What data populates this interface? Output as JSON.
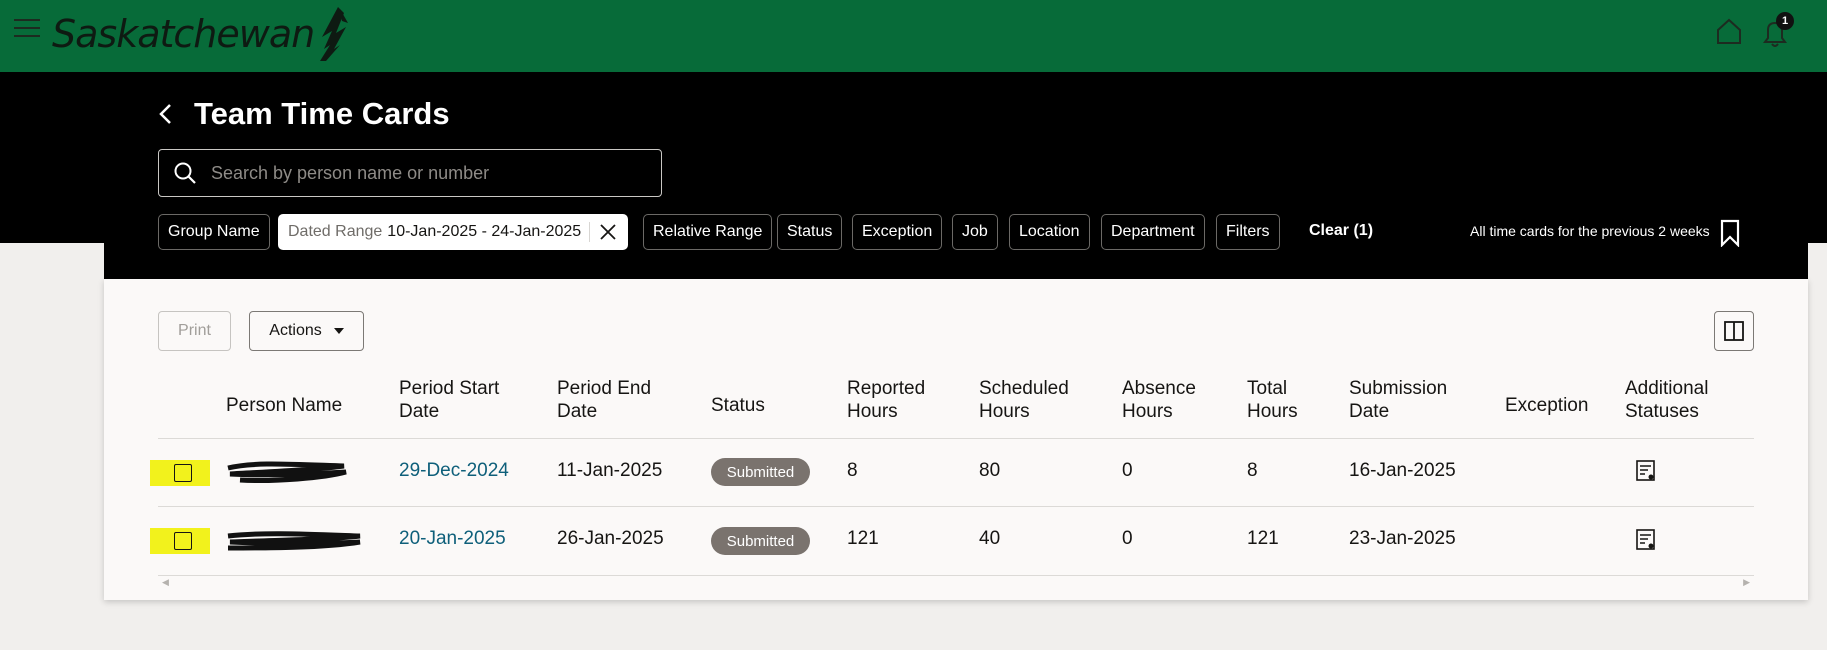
{
  "app": {
    "brand": "Saskatchewan",
    "notification_count": "1"
  },
  "header": {
    "title": "Team Time Cards",
    "search_placeholder": "Search by person name or number"
  },
  "filters": {
    "group_name": "Group Name",
    "dated_range_key": "Dated Range",
    "dated_range_value": "10-Jan-2025 - 24-Jan-2025",
    "relative_range": "Relative Range",
    "status": "Status",
    "exception": "Exception",
    "job": "Job",
    "location": "Location",
    "department": "Department",
    "filters": "Filters",
    "clear": "Clear (1)",
    "saved_search": "All time cards for the previous 2 weeks"
  },
  "toolbar": {
    "print": "Print",
    "actions": "Actions"
  },
  "table": {
    "columns": {
      "person_name": "Person Name",
      "period_start_1": "Period Start",
      "period_start_2": "Date",
      "period_end_1": "Period End",
      "period_end_2": "Date",
      "status": "Status",
      "reported_1": "Reported",
      "reported_2": "Hours",
      "scheduled_1": "Scheduled",
      "scheduled_2": "Hours",
      "absence_1": "Absence",
      "absence_2": "Hours",
      "total_1": "Total",
      "total_2": "Hours",
      "submission_1": "Submission",
      "submission_2": "Date",
      "exception": "Exception",
      "additional_1": "Additional",
      "additional_2": "Statuses"
    },
    "rows": [
      {
        "period_start": "29-Dec-2024",
        "period_end": "11-Jan-2025",
        "status": "Submitted",
        "reported": "8",
        "scheduled": "80",
        "absence": "0",
        "total": "8",
        "submission": "16-Jan-2025"
      },
      {
        "period_start": "20-Jan-2025",
        "period_end": "26-Jan-2025",
        "status": "Submitted",
        "reported": "121",
        "scheduled": "40",
        "absence": "0",
        "total": "121",
        "submission": "23-Jan-2025"
      }
    ]
  },
  "colors": {
    "brand_green": "#076b39",
    "header_black": "#000000",
    "link_blue": "#0e5f7a",
    "badge_gray": "#7a736e",
    "highlight_yellow": "#f2f21c"
  },
  "icons": [
    "hamburger-icon",
    "saskatchewan-logo",
    "home-icon",
    "bell-icon",
    "back-chevron-icon",
    "search-icon",
    "close-icon",
    "bookmark-icon",
    "split-panel-icon",
    "caret-down-icon",
    "status-details-icon"
  ]
}
